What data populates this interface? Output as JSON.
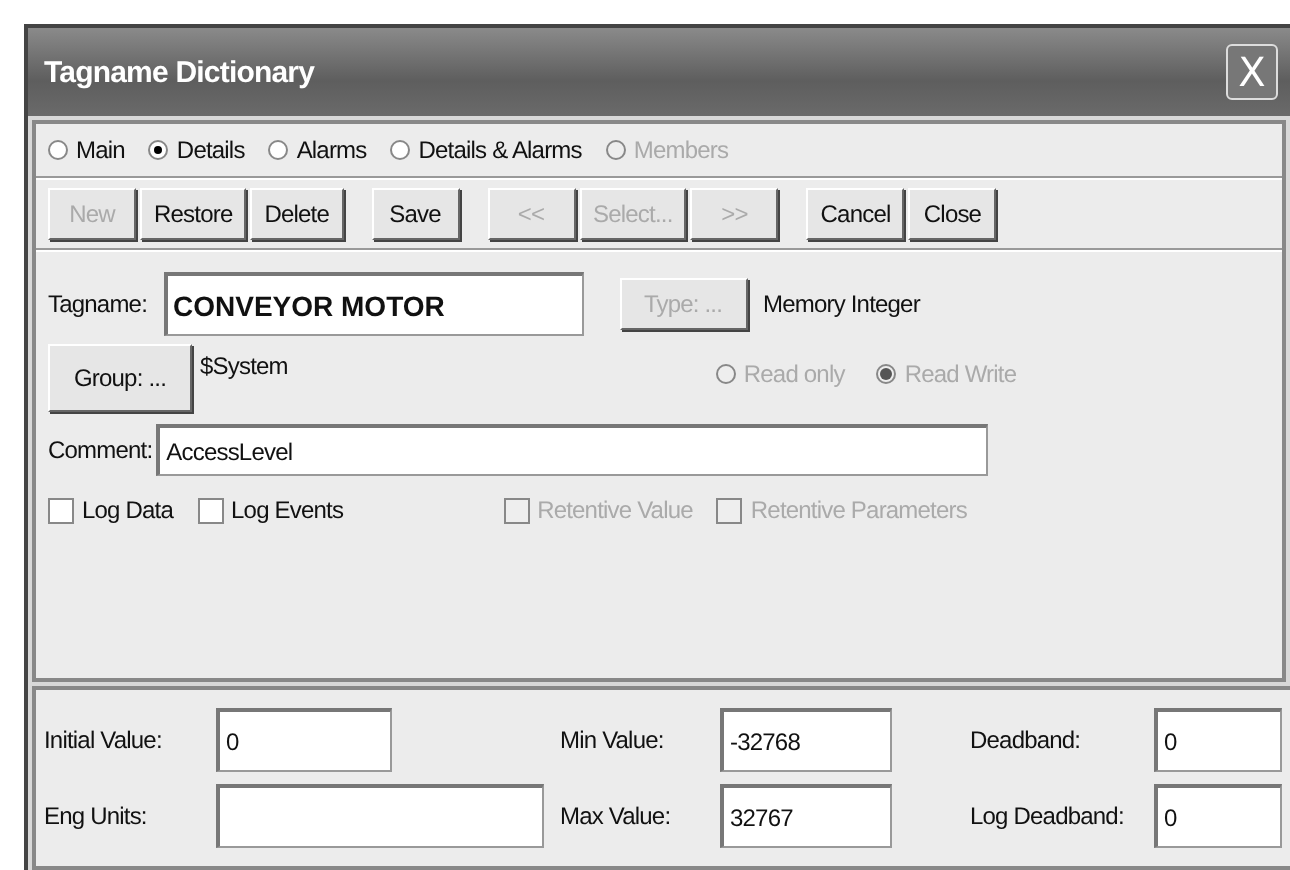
{
  "window": {
    "title": "Tagname Dictionary",
    "close": "X"
  },
  "views": [
    {
      "label": "Main",
      "selected": false,
      "disabled": false
    },
    {
      "label": "Details",
      "selected": true,
      "disabled": false
    },
    {
      "label": "Alarms",
      "selected": false,
      "disabled": false
    },
    {
      "label": "Details & Alarms",
      "selected": false,
      "disabled": false
    },
    {
      "label": "Members",
      "selected": false,
      "disabled": true
    }
  ],
  "button_groups": [
    [
      {
        "label": "New",
        "disabled": true
      },
      {
        "label": "Restore",
        "disabled": false
      },
      {
        "label": "Delete",
        "disabled": false
      }
    ],
    [
      {
        "label": "Save",
        "disabled": false
      }
    ],
    [
      {
        "label": "<<",
        "disabled": true
      },
      {
        "label": "Select...",
        "disabled": true
      },
      {
        "label": ">>",
        "disabled": true
      }
    ],
    [
      {
        "label": "Cancel",
        "disabled": false
      },
      {
        "label": "Close",
        "disabled": false
      }
    ]
  ],
  "tagname": {
    "label": "Tagname:",
    "value": "CONVEYOR MOTOR"
  },
  "type": {
    "button": "Type: ...",
    "disabled": true,
    "value": "Memory Integer"
  },
  "group": {
    "button": "Group: ...",
    "value": "$System"
  },
  "access": [
    {
      "label": "Read only",
      "selected": false,
      "disabled": true
    },
    {
      "label": "Read Write",
      "selected": true,
      "disabled": true
    }
  ],
  "comment": {
    "label": "Comment:",
    "value": "AccessLevel"
  },
  "options": [
    {
      "label": "Log Data",
      "checked": false,
      "disabled": false
    },
    {
      "label": "Log Events",
      "checked": false,
      "disabled": false
    },
    {
      "label": "Retentive Value",
      "checked": false,
      "disabled": true
    },
    {
      "label": "Retentive Parameters",
      "checked": false,
      "disabled": true
    }
  ],
  "values": [
    {
      "label": "Initial Value:",
      "value": "0",
      "kind": "short"
    },
    {
      "label": "Min Value:",
      "value": "-32768",
      "kind": "short"
    },
    {
      "label": "Deadband:",
      "value": "0",
      "kind": "short"
    },
    {
      "label": "Eng Units:",
      "kind": "long"
    },
    {
      "label": "Max Value:",
      "value": "32767",
      "kind": "short"
    },
    {
      "label": "Log Deadband:",
      "value": "0",
      "kind": "short"
    }
  ]
}
